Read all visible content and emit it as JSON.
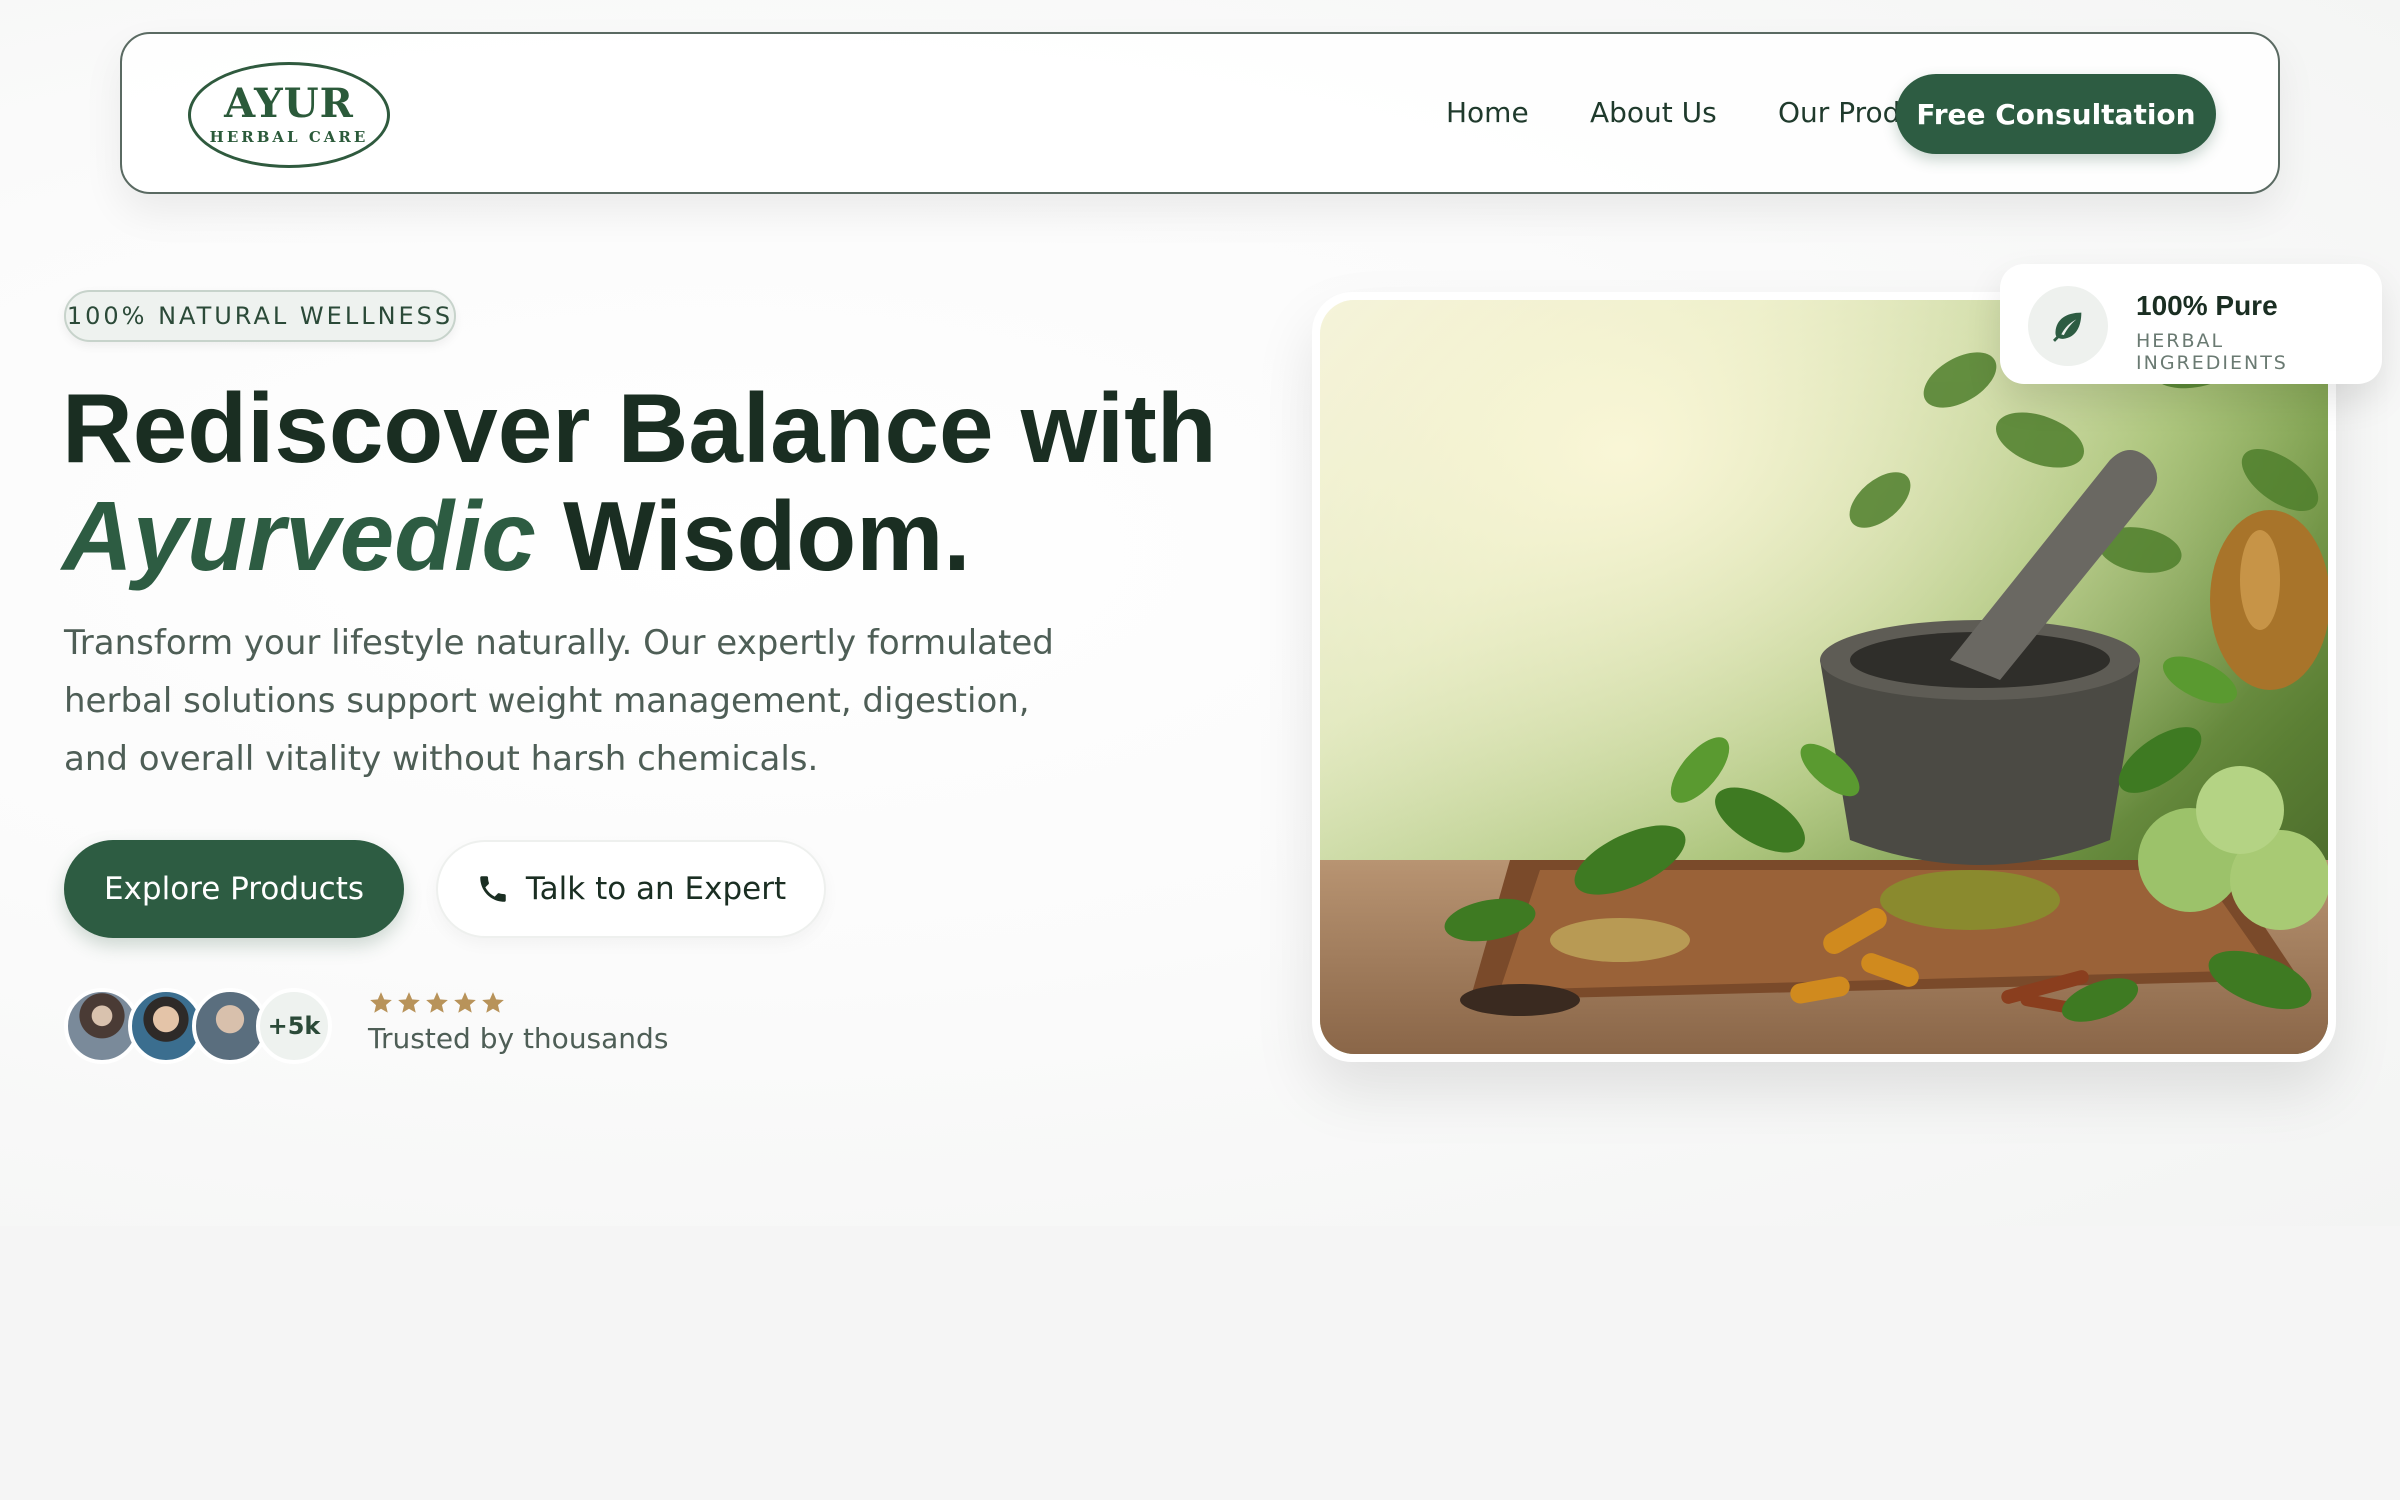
{
  "brand": {
    "logo_main": "AYUR",
    "logo_sub": "HERBAL CARE",
    "primary_color": "#2d5c42",
    "star_color": "#b8935a"
  },
  "nav": {
    "links": [
      "Home",
      "About Us",
      "Our Products"
    ],
    "cta_label": "Free Consultation"
  },
  "hero": {
    "pill_text": "100% NATURAL WELLNESS",
    "headline_line1": "Rediscover Balance with",
    "headline_accent": "Ayurvedic",
    "headline_rest": " Wisdom.",
    "description": "Transform your lifestyle naturally. Our expertly formulated herbal solutions support weight management, digestion, and overall vitality without harsh chemicals.",
    "primary_button": "Explore Products",
    "secondary_button": "Talk to an Expert",
    "secondary_icon": "phone-icon",
    "social_proof": {
      "extra_count": "+5k",
      "rating_stars": 5,
      "trust_text": "Trusted by thousands"
    }
  },
  "badge": {
    "icon": "leaf-icon",
    "title": "100% Pure",
    "subtitle": "HERBAL INGREDIENTS"
  }
}
